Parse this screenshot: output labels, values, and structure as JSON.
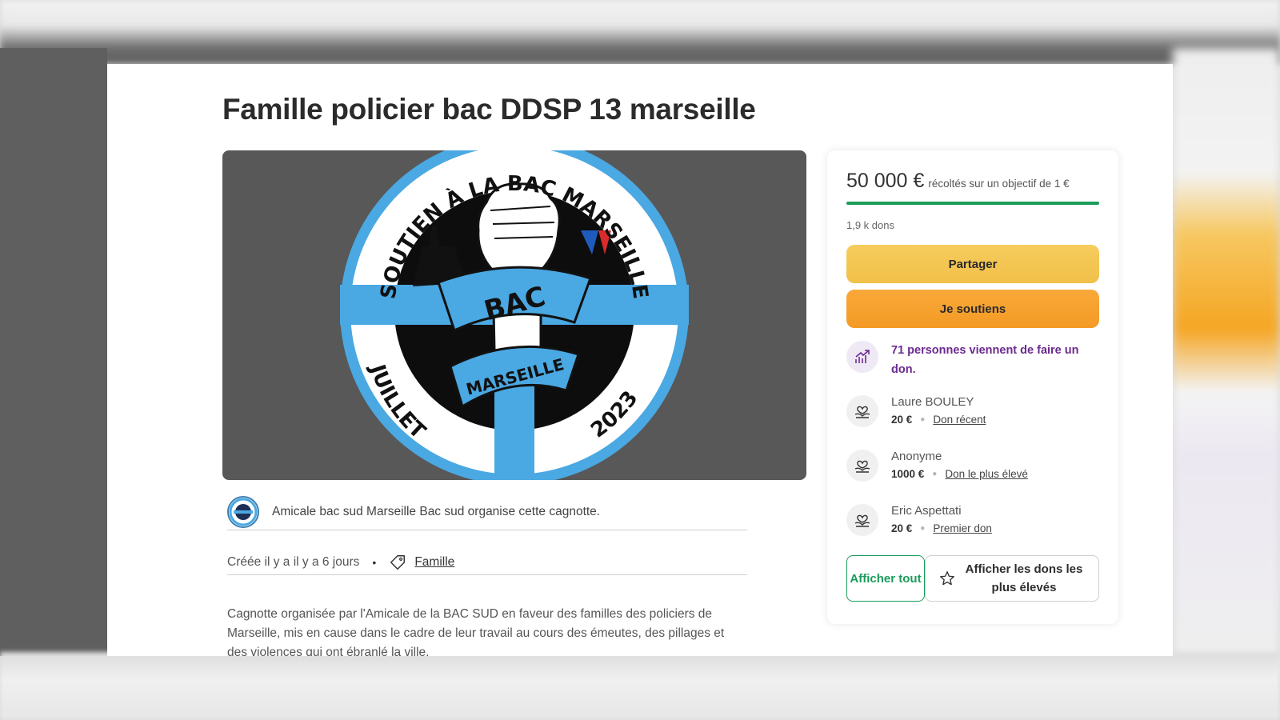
{
  "campaign": {
    "title": "Famille policier bac DDSP 13 marseille"
  },
  "hero_image": {
    "badge_top_text": "SOUTIEN À LA BAC MARSEILLE",
    "badge_left_text": "JUILLET",
    "badge_right_text": "2023",
    "ribbon_top": "BAC",
    "ribbon_bottom": "MARSEILLE",
    "colors": {
      "blue": "#4aa8e2",
      "navy": "#1e2f55",
      "background": "#585858"
    }
  },
  "organizer": {
    "text": "Amicale bac sud Marseille Bac sud organise cette cagnotte."
  },
  "meta": {
    "created": "Créée il y a il y a 6 jours",
    "separator": "•",
    "category": "Famille"
  },
  "description": {
    "text": "Cagnotte organisée par l'Amicale de la BAC SUD en faveur des familles des policiers de Marseille, mis en cause dans le cadre de leur travail au cours des émeutes, des pillages et des violences qui ont ébranlé la ville."
  },
  "donation_card": {
    "amount": "50 000 €",
    "amount_subtitle": "récoltés sur un objectif de 1 €",
    "progress_fraction": 1.0,
    "dons_count": "1,9 k dons",
    "share_label": "Partager",
    "support_label": "Je soutiens",
    "trend_text": "71 personnes viennent de faire un don.",
    "donors": [
      {
        "name": "Laure BOULEY",
        "amount": "20 €",
        "badge": "Don récent"
      },
      {
        "name": "Anonyme",
        "amount": "1000 €",
        "badge": "Don le plus élevé"
      },
      {
        "name": "Eric Aspettati",
        "amount": "20 €",
        "badge": "Premier don"
      }
    ],
    "show_all_label": "Afficher tout",
    "show_top_label": "Afficher les dons les plus élevés",
    "colors": {
      "green": "#199c5a",
      "yellow": "#f3c453",
      "orange": "#f5a12c",
      "purple": "#6b2a8f"
    }
  },
  "icons": {
    "tag": "tag-icon",
    "trend": "trend-up-icon",
    "donor": "heart-hand-icon",
    "star": "star-icon"
  }
}
